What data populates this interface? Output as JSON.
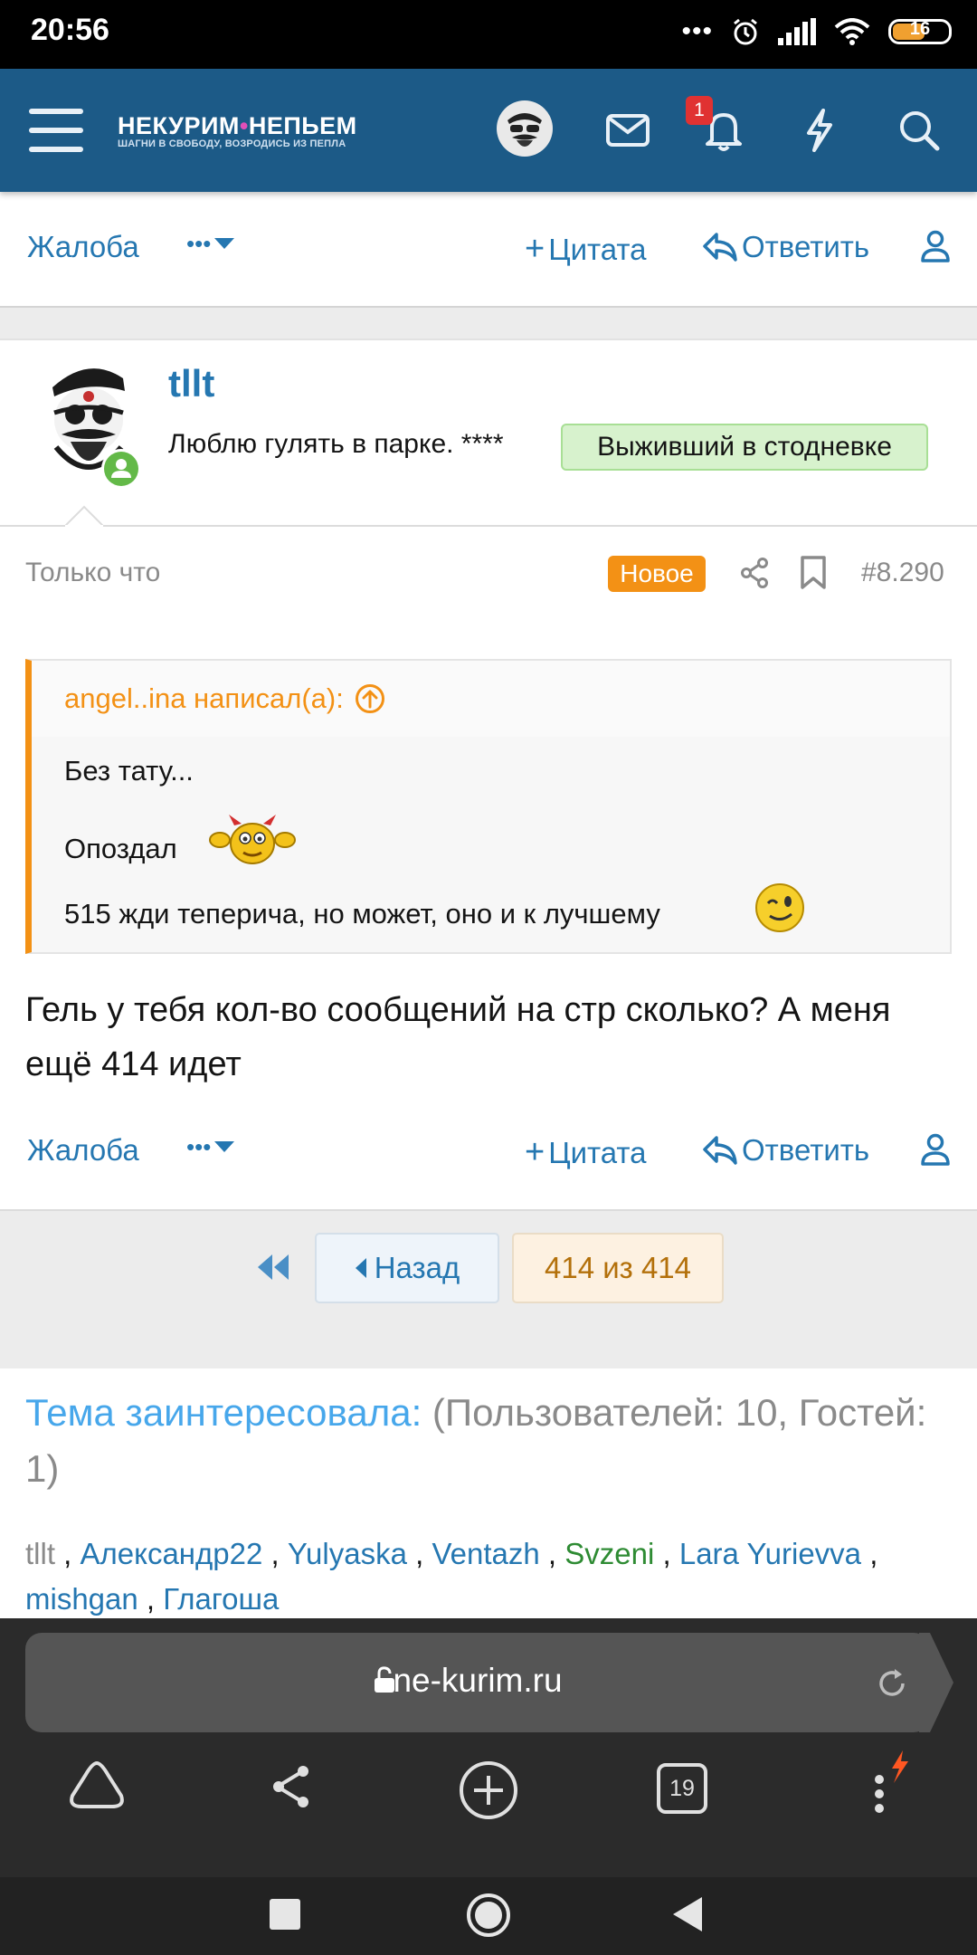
{
  "status": {
    "time": "20:56",
    "battery": "16"
  },
  "header": {
    "logo_main_1": "НЕКУРИМ",
    "logo_main_2": "НЕПЬЕМ",
    "logo_sub": "ШАГНИ В СВОБОДУ, ВОЗРОДИСЬ ИЗ ПЕПЛА",
    "notifications_count": "1"
  },
  "actions": {
    "report": "Жалоба",
    "more": "•••",
    "quote": "Цитата",
    "reply": "Ответить"
  },
  "post": {
    "username": "tllt",
    "user_title": "Люблю гулять в парке. ****",
    "banner": "Выживший в стодневке",
    "time": "Только что",
    "new_label": "Новое",
    "number": "#8.290",
    "quote": {
      "author": "angel..ina написал(а):",
      "line1": "Без тату...",
      "line2": "Опоздал",
      "line3": "515 жди теперича, но может, оно и к лучшему"
    },
    "message": "Гель у тебя кол-во сообщений на стр сколько? А меня ещё 414 идет"
  },
  "pagination": {
    "back": "Назад",
    "current": "414 из 414"
  },
  "interested": {
    "title": "Тема заинтересовала:",
    "counts": "(Пользователей: 10, Гостей: 1)",
    "users": [
      "tllt",
      "Александр22",
      "Yulyaska",
      "Ventazh",
      "Svzeni",
      "Lara Yurievva",
      "mishgan",
      "Глагоша"
    ]
  },
  "browser": {
    "url": "ne-kurim.ru",
    "tabs_count": "19"
  },
  "colors": {
    "header": "#1c5a87",
    "link": "#2577b1",
    "accent": "#f39115"
  }
}
